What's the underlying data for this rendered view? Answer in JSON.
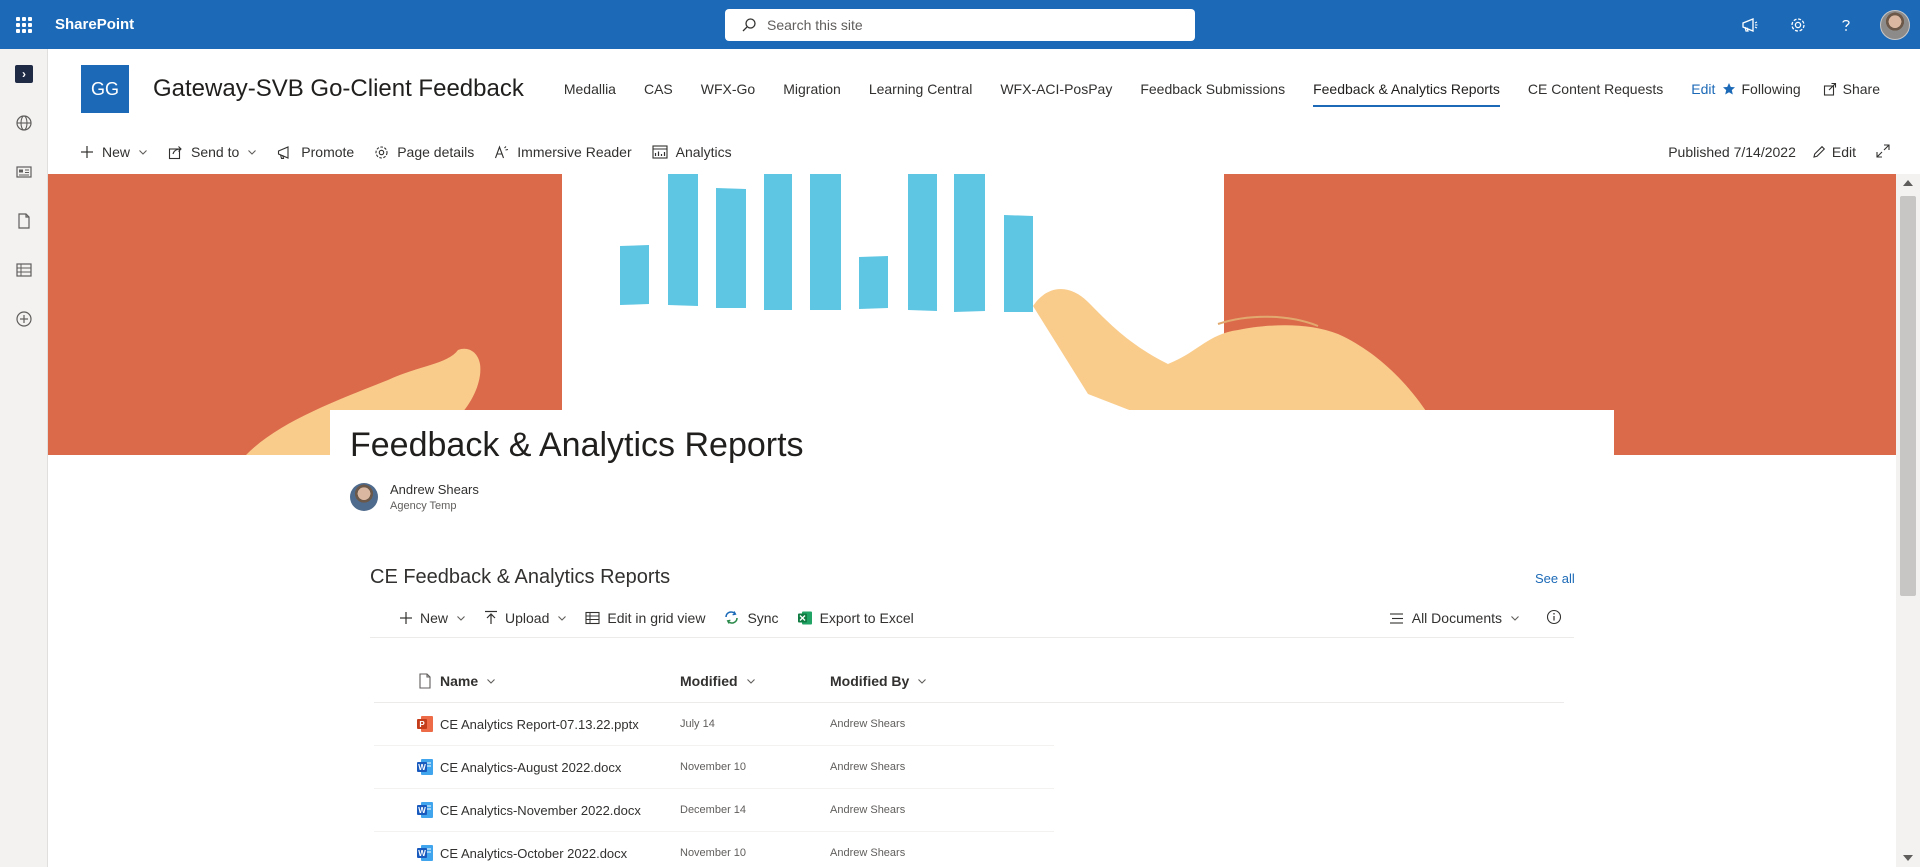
{
  "suite": {
    "app_name": "SharePoint",
    "search_placeholder": "Search this site"
  },
  "site": {
    "logo_initials": "GG",
    "title": "Gateway-SVB Go-Client Feedback",
    "nav": [
      {
        "label": "Medallia"
      },
      {
        "label": "CAS"
      },
      {
        "label": "WFX-Go"
      },
      {
        "label": "Migration"
      },
      {
        "label": "Learning Central"
      },
      {
        "label": "WFX-ACI-PosPay"
      },
      {
        "label": "Feedback Submissions"
      },
      {
        "label": "Feedback & Analytics Reports"
      },
      {
        "label": "CE Content Requests"
      }
    ],
    "nav_edit": "Edit",
    "following": "Following",
    "share": "Share"
  },
  "page_cmd": {
    "new": "New",
    "send_to": "Send to",
    "promote": "Promote",
    "page_details": "Page details",
    "immersive_reader": "Immersive Reader",
    "analytics": "Analytics",
    "published": "Published 7/14/2022",
    "edit": "Edit"
  },
  "page": {
    "title": "Feedback & Analytics Reports",
    "author_name": "Andrew Shears",
    "author_role": "Agency Temp"
  },
  "library": {
    "title": "CE Feedback & Analytics Reports",
    "see_all": "See all",
    "cmd": {
      "new": "New",
      "upload": "Upload",
      "edit_grid": "Edit in grid view",
      "sync": "Sync",
      "export": "Export to Excel",
      "view": "All Documents"
    },
    "columns": {
      "name": "Name",
      "modified": "Modified",
      "modified_by": "Modified By"
    },
    "rows": [
      {
        "name": "CE Analytics Report-07.13.22.pptx",
        "modified": "July 14",
        "modified_by": "Andrew Shears",
        "type": "pptx"
      },
      {
        "name": "CE Analytics-August 2022.docx",
        "modified": "November 10",
        "modified_by": "Andrew Shears",
        "type": "docx"
      },
      {
        "name": "CE Analytics-November 2022.docx",
        "modified": "December 14",
        "modified_by": "Andrew Shears",
        "type": "docx"
      },
      {
        "name": "CE Analytics-October 2022.docx",
        "modified": "November 10",
        "modified_by": "Andrew Shears",
        "type": "docx"
      }
    ]
  },
  "colors": {
    "accent": "#1c6ab7",
    "hero_orange": "#db6a4b",
    "hero_bar": "#5ec5e2",
    "hero_hand": "#f9cc8c"
  }
}
